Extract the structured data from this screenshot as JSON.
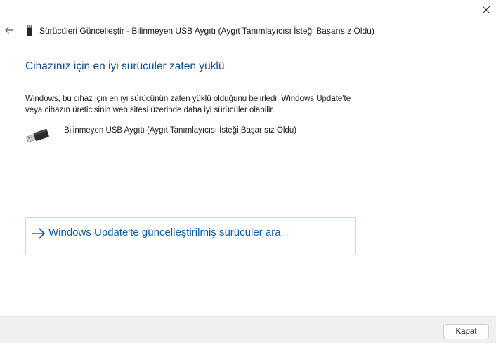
{
  "window": {
    "title": "Sürücüleri Güncelleştir - Bilinmeyen USB Aygıtı (Aygıt Tanımlayıcısı İsteği Başarısız Oldu)"
  },
  "icons": {
    "close": "close-icon",
    "back": "back-arrow-icon",
    "title_device": "usb-device-icon",
    "device": "usb-plug-icon",
    "link_arrow": "arrow-right-icon"
  },
  "main": {
    "heading": "Cihazınız için en iyi sürücüler zaten yüklü",
    "description_lines": [
      "Windows, bu cihaz için en iyi sürücünün zaten yüklü olduğunu belirledi. Windows Update'te",
      "veya cihazın üreticisinin web sitesi üzerinde daha iyi sürücüler olabilir."
    ],
    "device_name": "Bilinmeyen USB Aygıtı (Aygıt Tanımlayıcısı İsteği Başarısız Oldu)",
    "search_link_label": "Windows Update'te güncelleştirilmiş sürücüler ara"
  },
  "footer": {
    "close_label": "Kapat"
  },
  "colors": {
    "heading": "#0f4c8a",
    "link": "#0f5aa6",
    "link_border": "#c5dcee",
    "footer_bg": "#f0f0f0"
  }
}
